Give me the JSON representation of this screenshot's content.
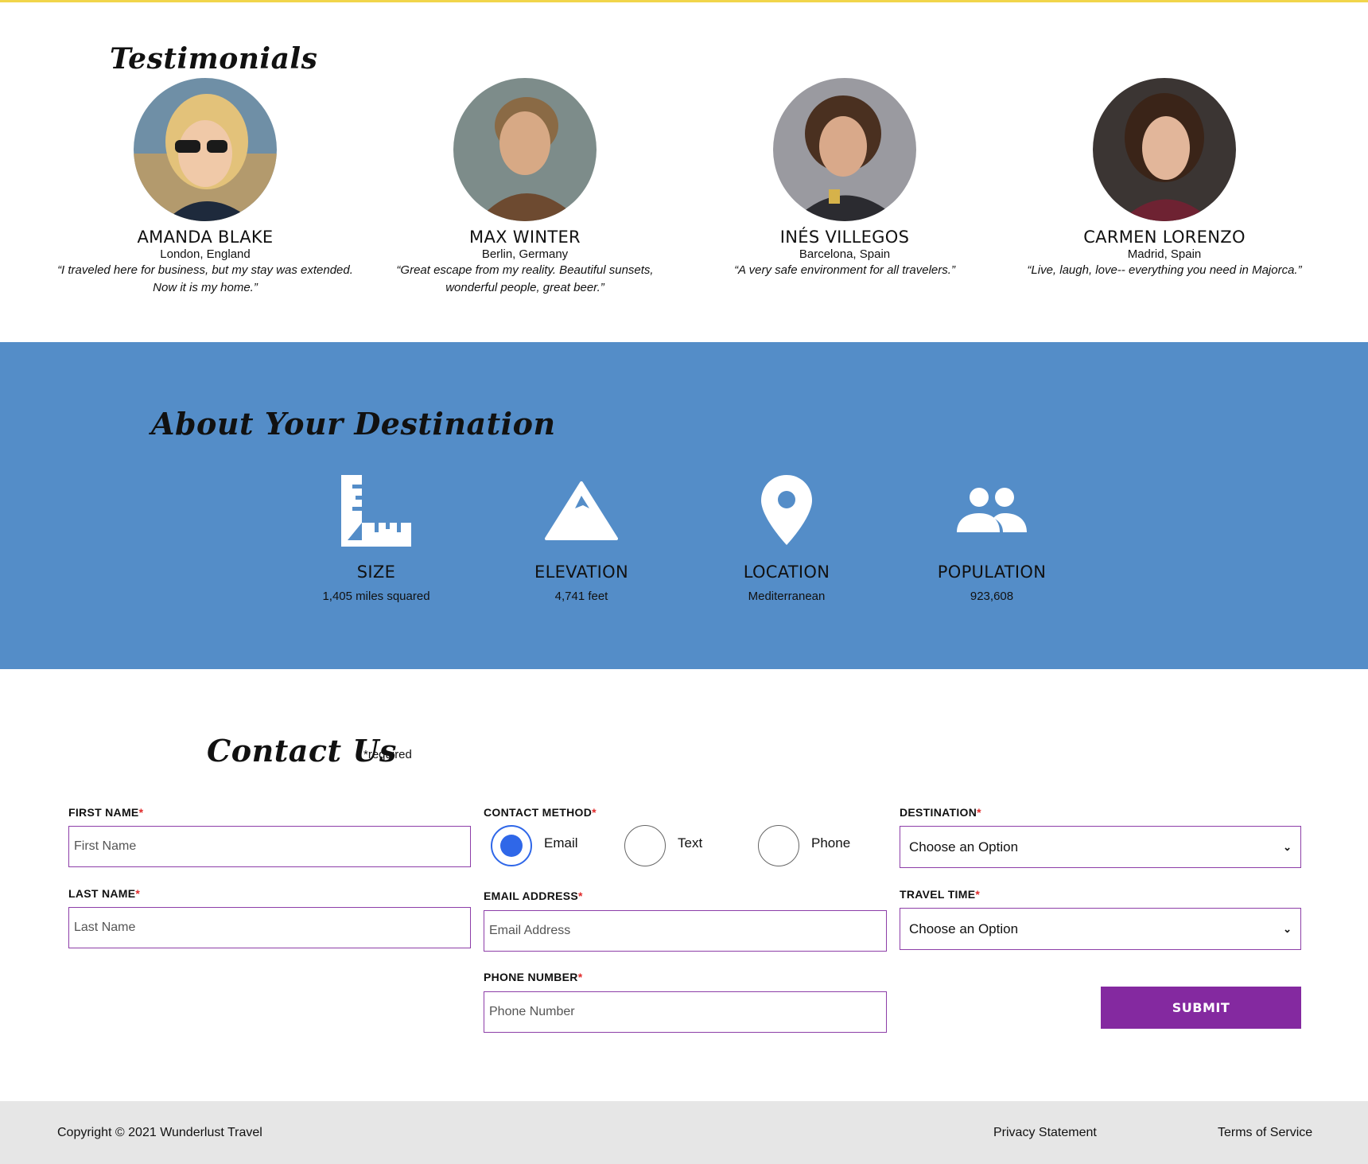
{
  "testimonials": {
    "heading": "Testimonials",
    "people": [
      {
        "name": "AMANDA BLAKE",
        "location": "London, England",
        "quote_line1": "“I traveled here for business, but my stay was extended.",
        "quote_line2": "Now it is my home.”"
      },
      {
        "name": "MAX WINTER",
        "location": "Berlin, Germany",
        "quote_line1": "“Great escape from my reality. Beautiful sunsets,",
        "quote_line2": "wonderful people, great beer.”"
      },
      {
        "name": "INÉS VILLEGOS",
        "location": "Barcelona, Spain",
        "quote_line1": "“A very safe environment for all travelers.”",
        "quote_line2": ""
      },
      {
        "name": "CARMEN LORENZO",
        "location": "Madrid, Spain",
        "quote_line1": "“Live, laugh, love-- everything you need in Majorca.”",
        "quote_line2": ""
      }
    ]
  },
  "about": {
    "heading": "About Your Destination",
    "stats": [
      {
        "icon": "ruler-icon",
        "label": "SIZE",
        "value": "1,405 miles squared"
      },
      {
        "icon": "mountain-icon",
        "label": "ELEVATION",
        "value": "4,741 feet"
      },
      {
        "icon": "map-pin-icon",
        "label": "LOCATION",
        "value": "Mediterranean"
      },
      {
        "icon": "people-icon",
        "label": "POPULATION",
        "value": "923,608"
      }
    ]
  },
  "contact": {
    "heading": "Contact Us",
    "required_note": "*required",
    "required_marker": "*",
    "first_name": {
      "label": "FIRST NAME",
      "placeholder": "First Name"
    },
    "last_name": {
      "label": "LAST NAME",
      "placeholder": "Last Name"
    },
    "contact_method": {
      "label": "CONTACT METHOD",
      "options": [
        "Email",
        "Text",
        "Phone"
      ],
      "selected": "Email"
    },
    "email": {
      "label": "EMAIL ADDRESS",
      "placeholder": "Email Address"
    },
    "phone": {
      "label": "PHONE NUMBER",
      "placeholder": "Phone Number"
    },
    "destination": {
      "label": "DESTINATION",
      "value": "Choose an Option"
    },
    "travel_time": {
      "label": "TRAVEL TIME",
      "value": "Choose an Option"
    },
    "submit_label": "SUBMIT"
  },
  "footer": {
    "copyright": "Copyright © 2021 Wunderlust Travel",
    "privacy": "Privacy Statement",
    "terms": "Terms of Service"
  },
  "colors": {
    "accent_bar": "#f1d54b",
    "about_bg": "#548dc8",
    "form_border": "#8d3ea8",
    "submit_bg": "#8429a0",
    "radio_selected": "#2f67e8",
    "required_star": "#e02a2a",
    "footer_bg": "#e6e6e6"
  }
}
